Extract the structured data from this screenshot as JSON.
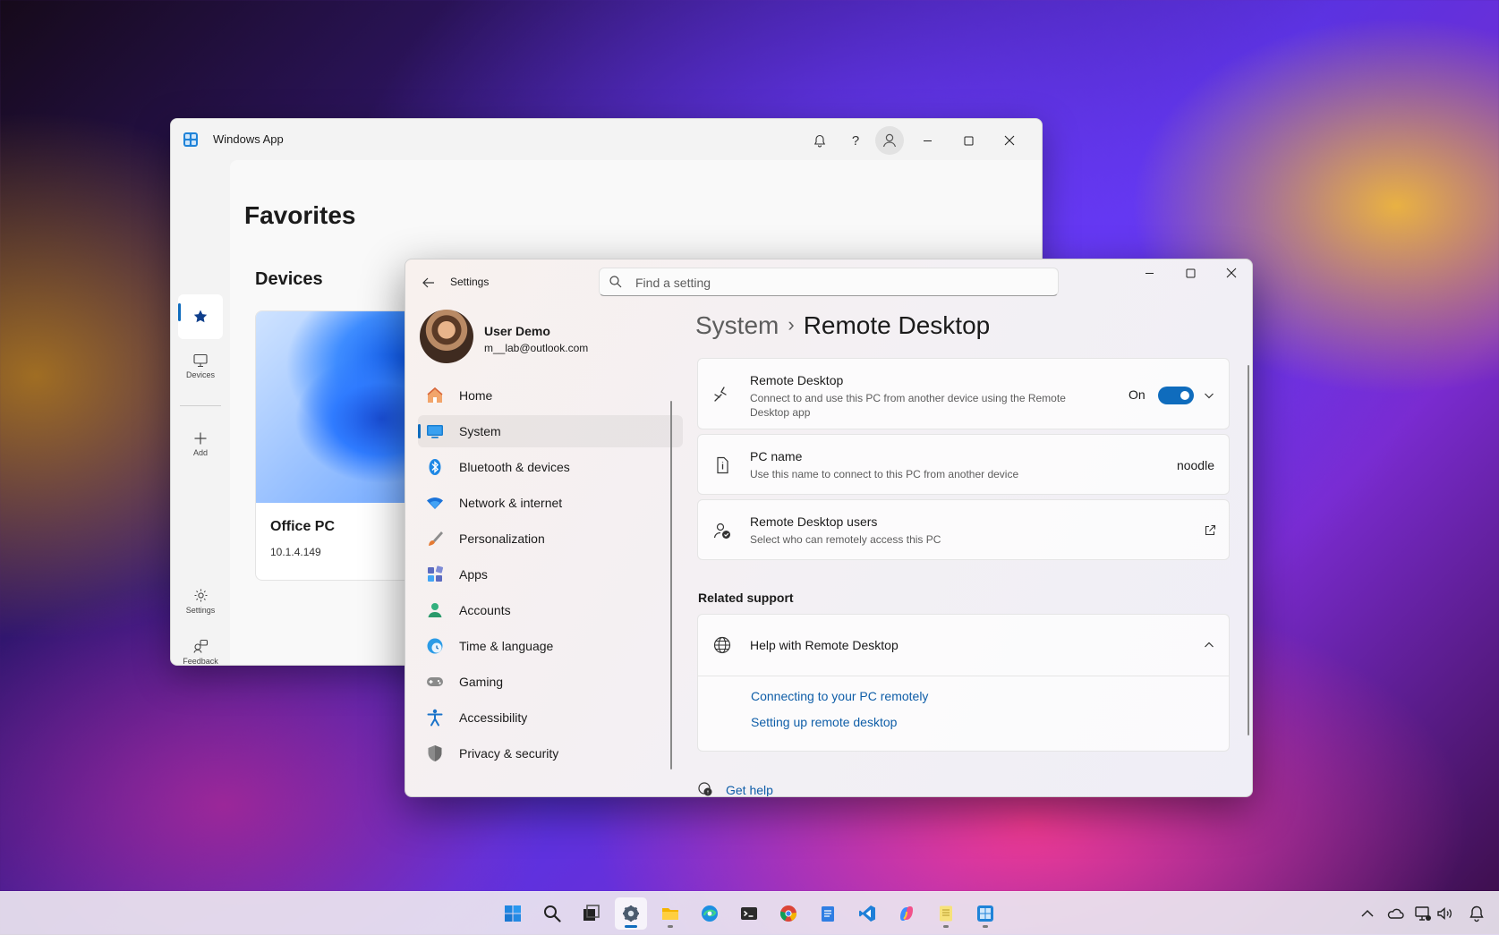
{
  "windows_app": {
    "title": "Windows App",
    "heading": "Favorites",
    "section": "Devices",
    "rail": {
      "favorites_label": "",
      "devices_label": "Devices",
      "add_label": "Add",
      "settings_label": "Settings",
      "feedback_label": "Feedback"
    },
    "device_card": {
      "name": "Office PC",
      "ip": "10.1.4.149"
    },
    "icons": [
      "bell-icon",
      "help-icon",
      "account-icon",
      "minimize-icon",
      "maximize-icon",
      "close-icon"
    ]
  },
  "settings": {
    "title": "Settings",
    "search": {
      "placeholder": "Find a setting",
      "value": ""
    },
    "user": {
      "name": "User Demo",
      "email": "m__lab@outlook.com"
    },
    "nav": [
      {
        "label": "Home",
        "icon": "home-icon",
        "color": "#e8834a"
      },
      {
        "label": "System",
        "icon": "system-icon",
        "color": "#0f6cbd"
      },
      {
        "label": "Bluetooth & devices",
        "icon": "bluetooth-icon",
        "color": "#1e88e5"
      },
      {
        "label": "Network & internet",
        "icon": "wifi-icon",
        "color": "#1976d2"
      },
      {
        "label": "Personalization",
        "icon": "brush-icon",
        "color": "#e07b39"
      },
      {
        "label": "Apps",
        "icon": "apps-icon",
        "color": "#5b6ee1"
      },
      {
        "label": "Accounts",
        "icon": "person-icon",
        "color": "#2fae7a"
      },
      {
        "label": "Time & language",
        "icon": "globe-clock-icon",
        "color": "#1f8fd6"
      },
      {
        "label": "Gaming",
        "icon": "gamepad-icon",
        "color": "#7b7b7b"
      },
      {
        "label": "Accessibility",
        "icon": "accessibility-icon",
        "color": "#1a73c9"
      },
      {
        "label": "Privacy & security",
        "icon": "shield-icon",
        "color": "#7c7c7c"
      }
    ],
    "breadcrumb": {
      "parent": "System",
      "separator": "›",
      "current": "Remote Desktop"
    },
    "remote_desktop": {
      "title": "Remote Desktop",
      "description": "Connect to and use this PC from another device using the Remote Desktop app",
      "state_label": "On",
      "enabled": true
    },
    "pc_name": {
      "title": "PC name",
      "description": "Use this name to connect to this PC from another device",
      "value": "noodle"
    },
    "users": {
      "title": "Remote Desktop users",
      "description": "Select who can remotely access this PC"
    },
    "related_support": {
      "heading": "Related support",
      "help_title": "Help with Remote Desktop",
      "links": [
        "Connecting to your PC remotely",
        "Setting up remote desktop"
      ]
    },
    "get_help": "Get help"
  },
  "taskbar": {
    "apps": [
      "start-icon",
      "search-icon",
      "task-view-icon",
      "settings-icon",
      "file-explorer-icon",
      "edge-icon",
      "terminal-icon",
      "chrome-icon",
      "notepad-icon",
      "vscode-icon",
      "copilot-icon",
      "notes-icon",
      "windows-app-icon"
    ],
    "tray": [
      "chevron-up-icon",
      "onedrive-icon",
      "network-icon",
      "volume-icon",
      "notification-icon"
    ]
  },
  "colors": {
    "accent": "#0f6cbd",
    "link": "#0f5ea8"
  }
}
